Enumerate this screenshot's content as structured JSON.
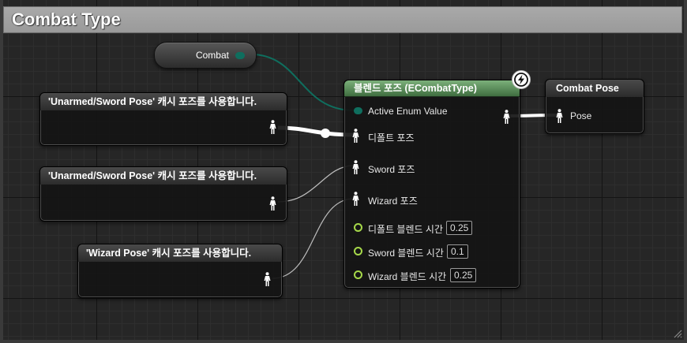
{
  "graph": {
    "title": "Combat Type"
  },
  "variable_node": {
    "label": "Combat"
  },
  "cache_nodes": [
    {
      "title": "'Unarmed/Sword Pose' 캐시 포즈를 사용합니다."
    },
    {
      "title": "'Unarmed/Sword Pose' 캐시 포즈를 사용합니다."
    },
    {
      "title": "'Wizard Pose' 캐시 포즈를 사용합니다."
    }
  ],
  "blend_node": {
    "title": "블렌드 포즈 (ECombatType)",
    "pins": {
      "active_enum": "Active Enum Value",
      "default_pose": "디폴트 포즈",
      "sword_pose": "Sword 포즈",
      "wizard_pose": "Wizard 포즈"
    },
    "blend_times": [
      {
        "label": "디폴트 블렌드 시간",
        "value": "0.25"
      },
      {
        "label": "Sword 블렌드 시간",
        "value": "0.1"
      },
      {
        "label": "Wizard 블렌드 시간",
        "value": "0.25"
      }
    ]
  },
  "output_node": {
    "title": "Combat Pose",
    "pin": "Pose"
  },
  "colors": {
    "enum_wire": "#0f6e5e",
    "float_pin": "#a6d84a",
    "blend_header": "#5a8f5a"
  },
  "icons": {
    "pose_pin": "pose-figure-icon",
    "fast_path": "lightning-bolt-icon",
    "resize": "resize-grip-icon"
  }
}
